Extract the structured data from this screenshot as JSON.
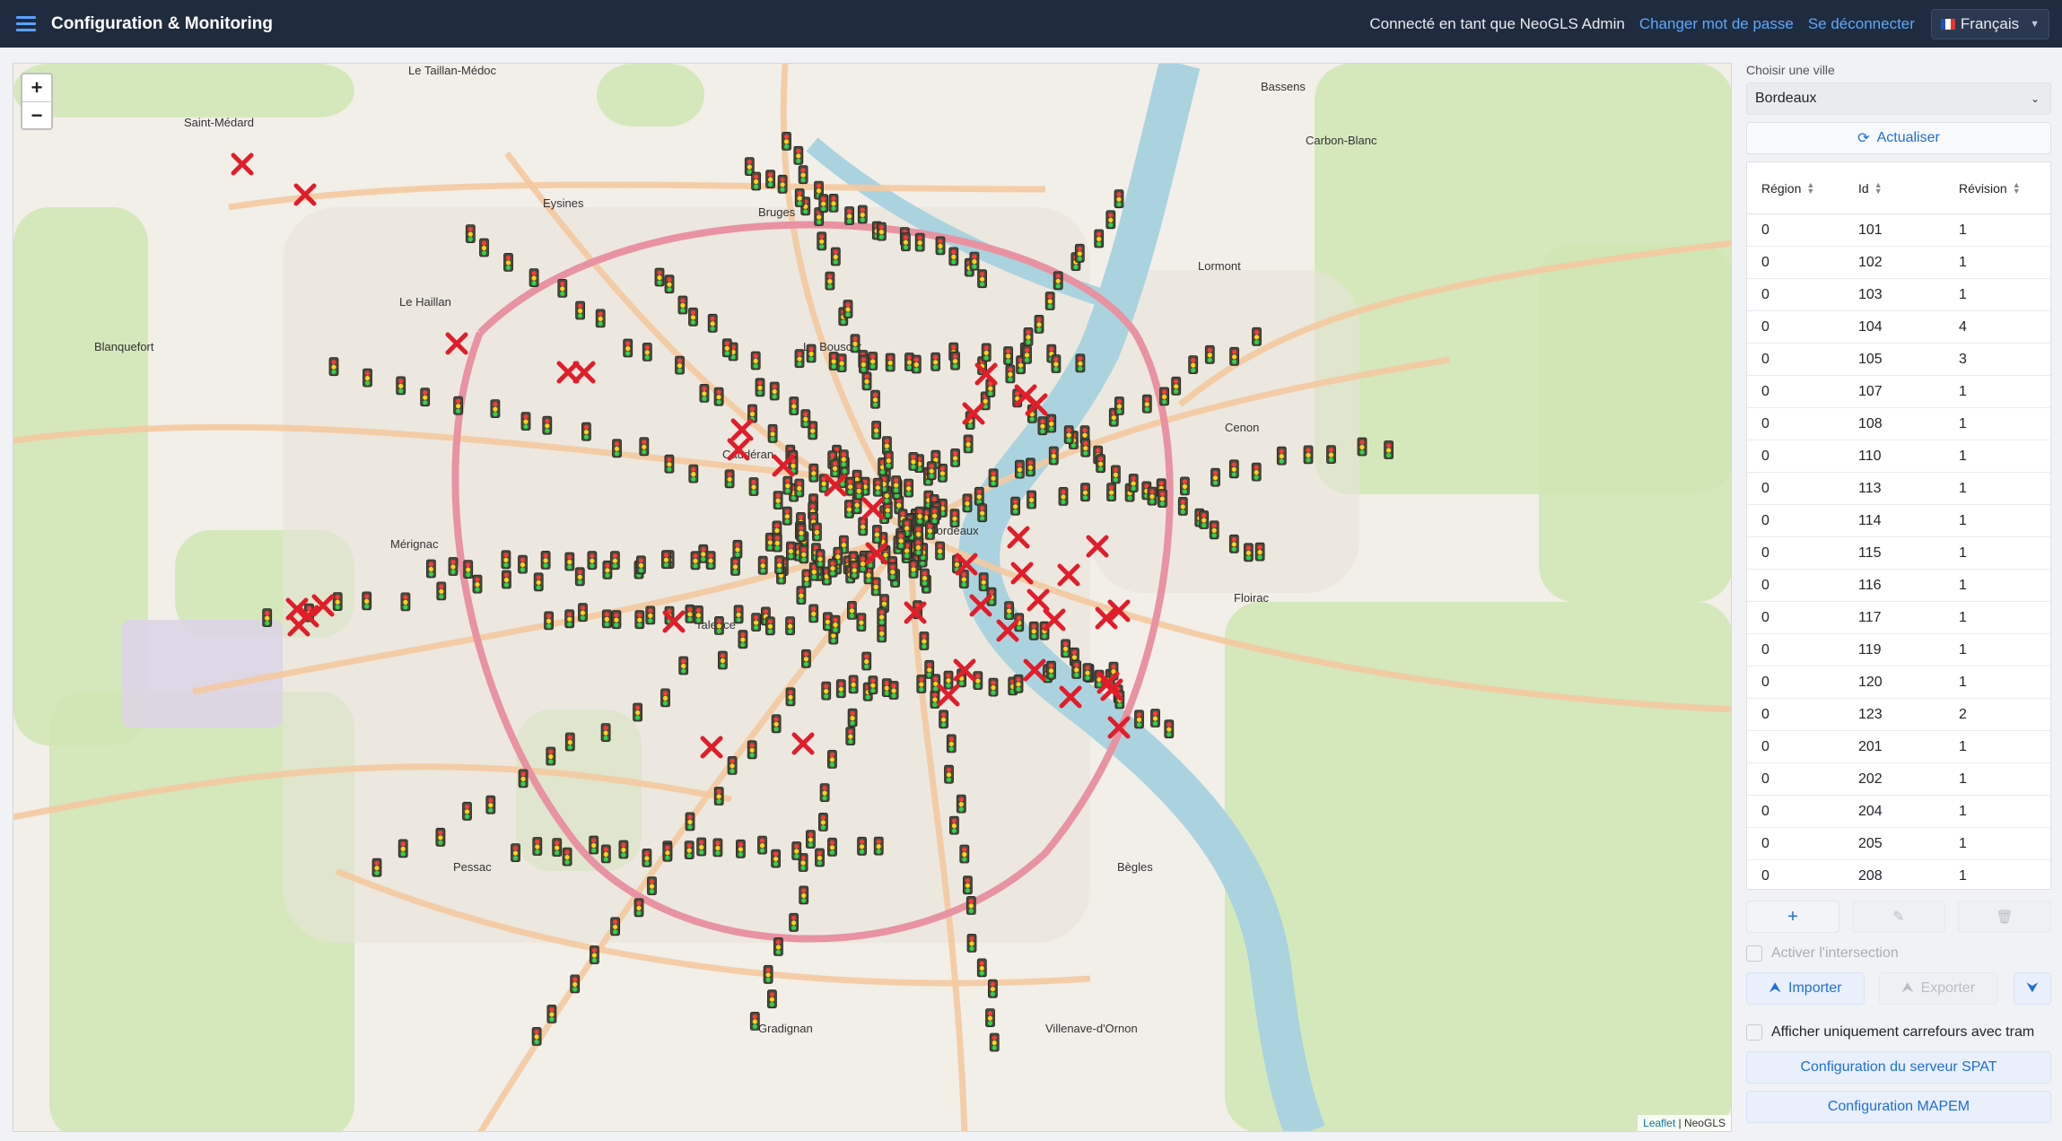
{
  "app": {
    "title": "Configuration & Monitoring"
  },
  "header": {
    "logged_in": "Connecté en tant que NeoGLS Admin",
    "change_password": "Changer mot de passe",
    "logout": "Se déconnecter",
    "language": "Français"
  },
  "map": {
    "zoom_in": "+",
    "zoom_out": "−",
    "attribution_leaflet": "Leaflet",
    "attribution_sep": " | ",
    "attribution_owner": "NeoGLS",
    "places": [
      "Le Taillan-Médoc",
      "Saint-Médard",
      "Le Haillan",
      "Eysines",
      "Bruges",
      "Le Bouscat",
      "Mérignac",
      "Caudéran",
      "Bordeaux",
      "Talence",
      "Pessac",
      "Bègles",
      "Floirac",
      "Cenon",
      "Lormont",
      "Bassens",
      "Carbon-Blanc",
      "Villenave-d'Ornon",
      "Gradignan",
      "Blanquefort"
    ]
  },
  "panel": {
    "city_label": "Choisir une ville",
    "city_value": "Bordeaux",
    "refresh": "Actualiser",
    "columns": [
      "Région",
      "Id",
      "Révision"
    ],
    "rows": [
      [
        "0",
        "101",
        "1"
      ],
      [
        "0",
        "102",
        "1"
      ],
      [
        "0",
        "103",
        "1"
      ],
      [
        "0",
        "104",
        "4"
      ],
      [
        "0",
        "105",
        "3"
      ],
      [
        "0",
        "107",
        "1"
      ],
      [
        "0",
        "108",
        "1"
      ],
      [
        "0",
        "110",
        "1"
      ],
      [
        "0",
        "113",
        "1"
      ],
      [
        "0",
        "114",
        "1"
      ],
      [
        "0",
        "115",
        "1"
      ],
      [
        "0",
        "116",
        "1"
      ],
      [
        "0",
        "117",
        "1"
      ],
      [
        "0",
        "119",
        "1"
      ],
      [
        "0",
        "120",
        "1"
      ],
      [
        "0",
        "123",
        "2"
      ],
      [
        "0",
        "201",
        "1"
      ],
      [
        "0",
        "202",
        "1"
      ],
      [
        "0",
        "204",
        "1"
      ],
      [
        "0",
        "205",
        "1"
      ],
      [
        "0",
        "208",
        "1"
      ]
    ],
    "activate_intersection": "Activer l'intersection",
    "import": "Importer",
    "export": "Exporter",
    "tram_only": "Afficher uniquement carrefours avec tram",
    "spat_config": "Configuration du serveur SPAT",
    "mapem_config": "Configuration MAPEM"
  },
  "colors": {
    "header_bg": "#1f2b3e",
    "accent": "#1e6fd9",
    "link": "#5ea8ff"
  },
  "icons": [
    "menu-icon",
    "refresh-icon",
    "sort-icon",
    "plus-icon",
    "edit-icon",
    "trash-icon",
    "upload-icon",
    "download-icon",
    "traffic-light-icon",
    "error-cross-icon"
  ]
}
